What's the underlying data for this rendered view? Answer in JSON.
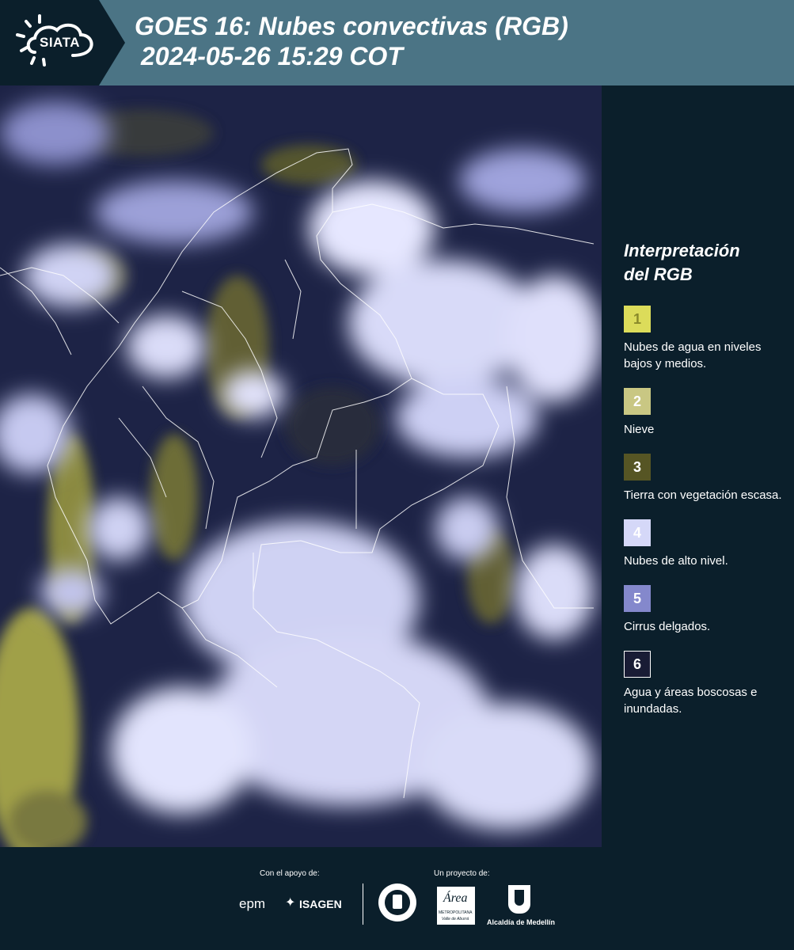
{
  "header": {
    "logo_text": "SIATA",
    "title": "GOES 16: Nubes convectivas (RGB)",
    "datetime": "2024-05-26 15:29 COT"
  },
  "map": {
    "description_icon": "satellite-image"
  },
  "legend": {
    "title": "Interpretación\ndel RGB",
    "items": [
      {
        "number": "1",
        "color": "#dcdc5a",
        "border": "#dcdc5a",
        "label": "Nubes de agua en niveles bajos y medios."
      },
      {
        "number": "2",
        "color": "#c9c783",
        "border": "#c9c783",
        "label": "Nieve"
      },
      {
        "number": "3",
        "color": "#565524",
        "border": "#565524",
        "label": "Tierra con vegetación escasa."
      },
      {
        "number": "4",
        "color": "#d5d8f8",
        "border": "#d5d8f8",
        "label": "Nubes de alto nivel."
      },
      {
        "number": "5",
        "color": "#8488cc",
        "border": "#8488cc",
        "label": "Cirrus delgados."
      },
      {
        "number": "6",
        "color": "#191c35",
        "border": "#ffffff",
        "label": "Agua y áreas boscosas e inundadas."
      }
    ]
  },
  "footer": {
    "support_caption": "Con el apoyo de:",
    "project_caption": "Un proyecto de:",
    "sponsors": [
      "epm",
      "ISAGEN"
    ],
    "partners": [
      "Área Metropolitana Valle de Aburrá",
      "Alcaldía de Medellín"
    ],
    "partner_area_name": "Área",
    "partner_area_sub": "METROPOLITANA",
    "partner_area_sub2": "Valle de Aburrá",
    "partner_alcaldia": "Alcaldía de Medellín"
  },
  "colors": {
    "header_bg": "#4b7485",
    "logo_bg": "#0b1f2b",
    "page_bg": "#0b1f2b"
  }
}
